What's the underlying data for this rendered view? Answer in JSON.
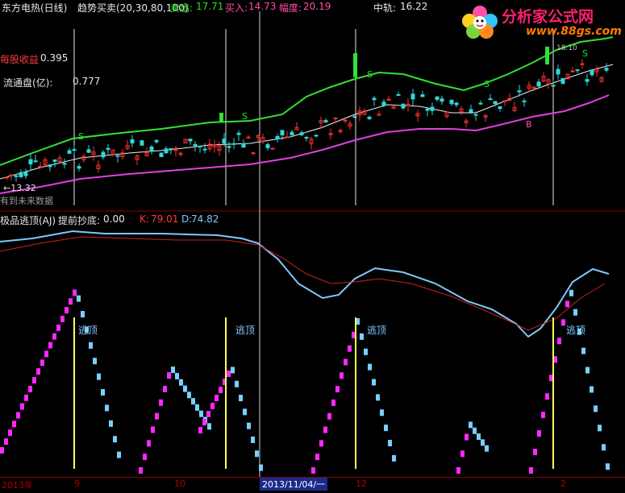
{
  "header": {
    "stock_name": "东方电热(日线)",
    "indicator": "趋势买卖(20,30,80,100)",
    "sell_label": "卖出:",
    "sell_value": "17.71",
    "buy_label": "买入:",
    "buy_value": "14.73",
    "amp_label": "幅度:",
    "amp_value": "20.19",
    "mid_label": "中轨:",
    "mid_value": "16.22"
  },
  "upper_panel": {
    "eps_label": "每股收益",
    "eps_value": "0.395",
    "float_label": "流通盘(亿):",
    "float_value": "0.777",
    "low_marker": "←13.32",
    "future_label": "有到未来数据",
    "sell_marks": [
      "S",
      "S",
      "S",
      "S",
      "S"
    ],
    "buy_marks": [
      "B"
    ],
    "high_marker": "18.10"
  },
  "lower_panel": {
    "title": "极品逃顶(AJ)",
    "subtitle": "提前抄底:",
    "subtitle_value": "0.00",
    "k_label": "K:",
    "k_value": "79.01",
    "d_label": "D:",
    "d_value": "74.82",
    "escape_label": "逃顶"
  },
  "date_axis": {
    "labels": [
      "2013年",
      "9",
      "10",
      "12",
      "2"
    ],
    "selected_date": "2013/11/04/一"
  },
  "watermark": {
    "title": "分析家公式网",
    "url": "www.88gs.com"
  },
  "colors": {
    "upper_band": "#33e033",
    "lower_band": "#e040e0",
    "mid_line": "#f0f0f0",
    "up_candle": "#ff3030",
    "down_candle": "#30d8d8",
    "k_line": "#7fc8ff",
    "d_line": "#d02020",
    "bar_magenta": "#ff28ff",
    "bar_cyan": "#79d0ff",
    "signal_line": "#ffff60"
  }
}
